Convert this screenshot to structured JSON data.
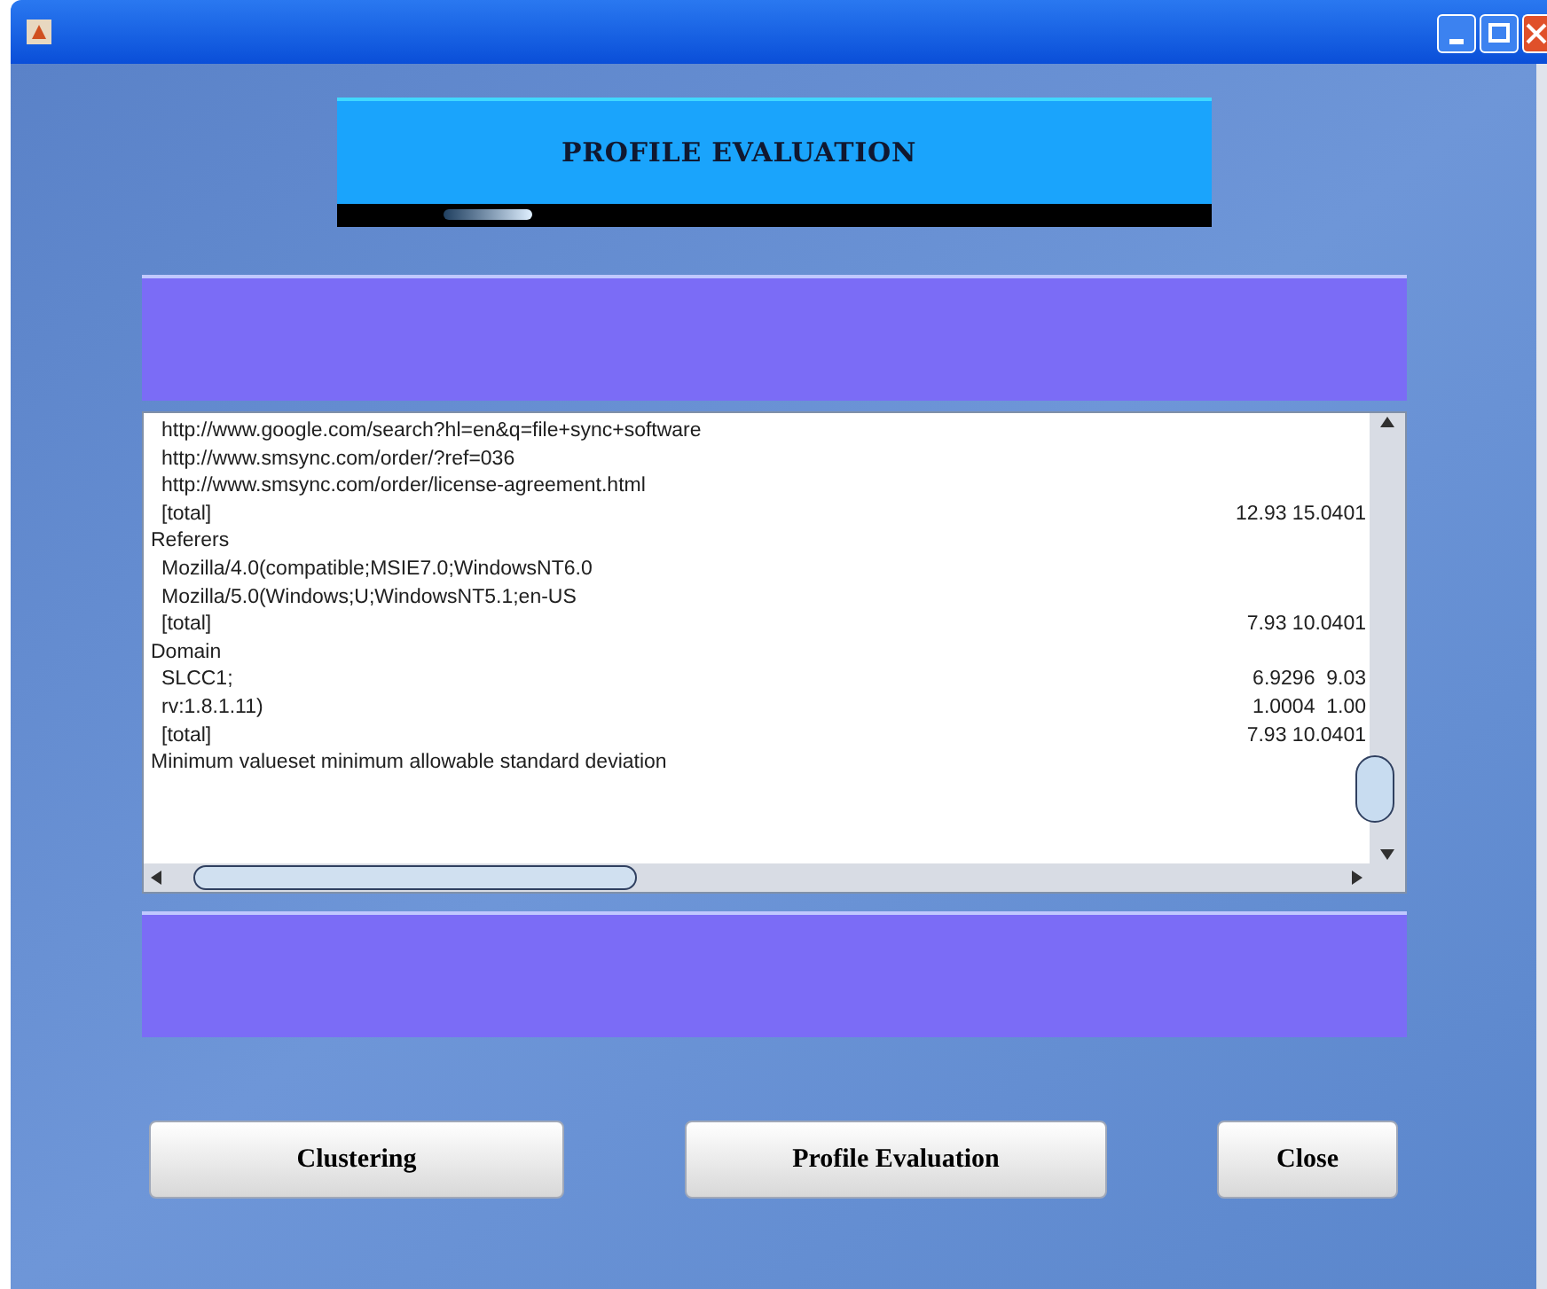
{
  "header": {
    "title": "PROFILE EVALUATION"
  },
  "report": {
    "continued_rows": [
      {
        "text": "http://www.google.com/search?hl=en&q=file+sync+software"
      },
      {
        "text": "http://www.smsync.com/order/?ref=036"
      },
      {
        "text": "http://www.smsync.com/order/license-agreement.html"
      },
      {
        "text": "[total]",
        "values": "12.93 15.0401"
      }
    ],
    "sections": [
      {
        "text": "Referers",
        "children": [
          {
            "text": "Mozilla/4.0(compatible;MSIE7.0;WindowsNT6.0"
          },
          {
            "text": "Mozilla/5.0(Windows;U;WindowsNT5.1;en-US"
          },
          {
            "text": "[total]",
            "values": "7.93 10.0401"
          }
        ]
      },
      {
        "text": "Domain",
        "children": [
          {
            "text": "SLCC1;",
            "values": "6.9296  9.03"
          },
          {
            "text": "rv:1.8.1.11)",
            "values": "1.0004  1.00"
          },
          {
            "text": "[total]",
            "values": "7.93 10.0401"
          }
        ]
      },
      {
        "text": "Minimum valueset minimum allowable standard deviation"
      }
    ]
  },
  "buttons": [
    {
      "label": "Clustering"
    },
    {
      "label": "Profile Evaluation"
    },
    {
      "label": "Close"
    }
  ]
}
